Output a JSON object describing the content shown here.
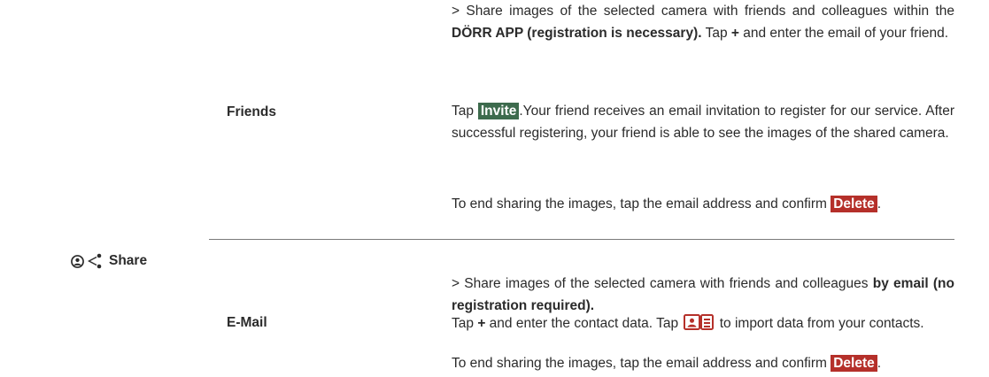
{
  "side": {
    "share_label": "Share",
    "icons": [
      "user-circle-icon",
      "share-nodes-icon"
    ]
  },
  "friends": {
    "label": "Friends",
    "intro": {
      "part1": "> Share images of the selected camera with friends and colleagues within the ",
      "bold": "DÖRR APP (registration is necessary).",
      "part2": " Tap ",
      "plus": "+",
      "part3": " and enter the email of your friend."
    },
    "invite": {
      "part1": "Tap ",
      "button": "Invite",
      "part2": ".Your friend receives an email invitation to register for our service. After successful registering, your friend is able to see the images of the shared camera."
    },
    "end_sharing": {
      "text": "To end sharing the images, tap the email address and confirm ",
      "button": "Delete",
      "after": "."
    }
  },
  "email": {
    "label": "E-Mail",
    "intro": {
      "part1": "> Share images of the selected camera with friends and colleagues ",
      "bold": "by email (no registration required)."
    },
    "contact": {
      "part1": "Tap ",
      "plus": "+",
      "part2": " and enter the contact data. Tap ",
      "part3": " to import data from your contacts."
    },
    "end_sharing": {
      "text": "To end sharing the images, tap the email address and confirm ",
      "button": "Delete",
      "after": "."
    }
  },
  "colors": {
    "invite_tag": "#3d6b4d",
    "delete_tag": "#b5302a",
    "text": "#2b2b2b"
  }
}
